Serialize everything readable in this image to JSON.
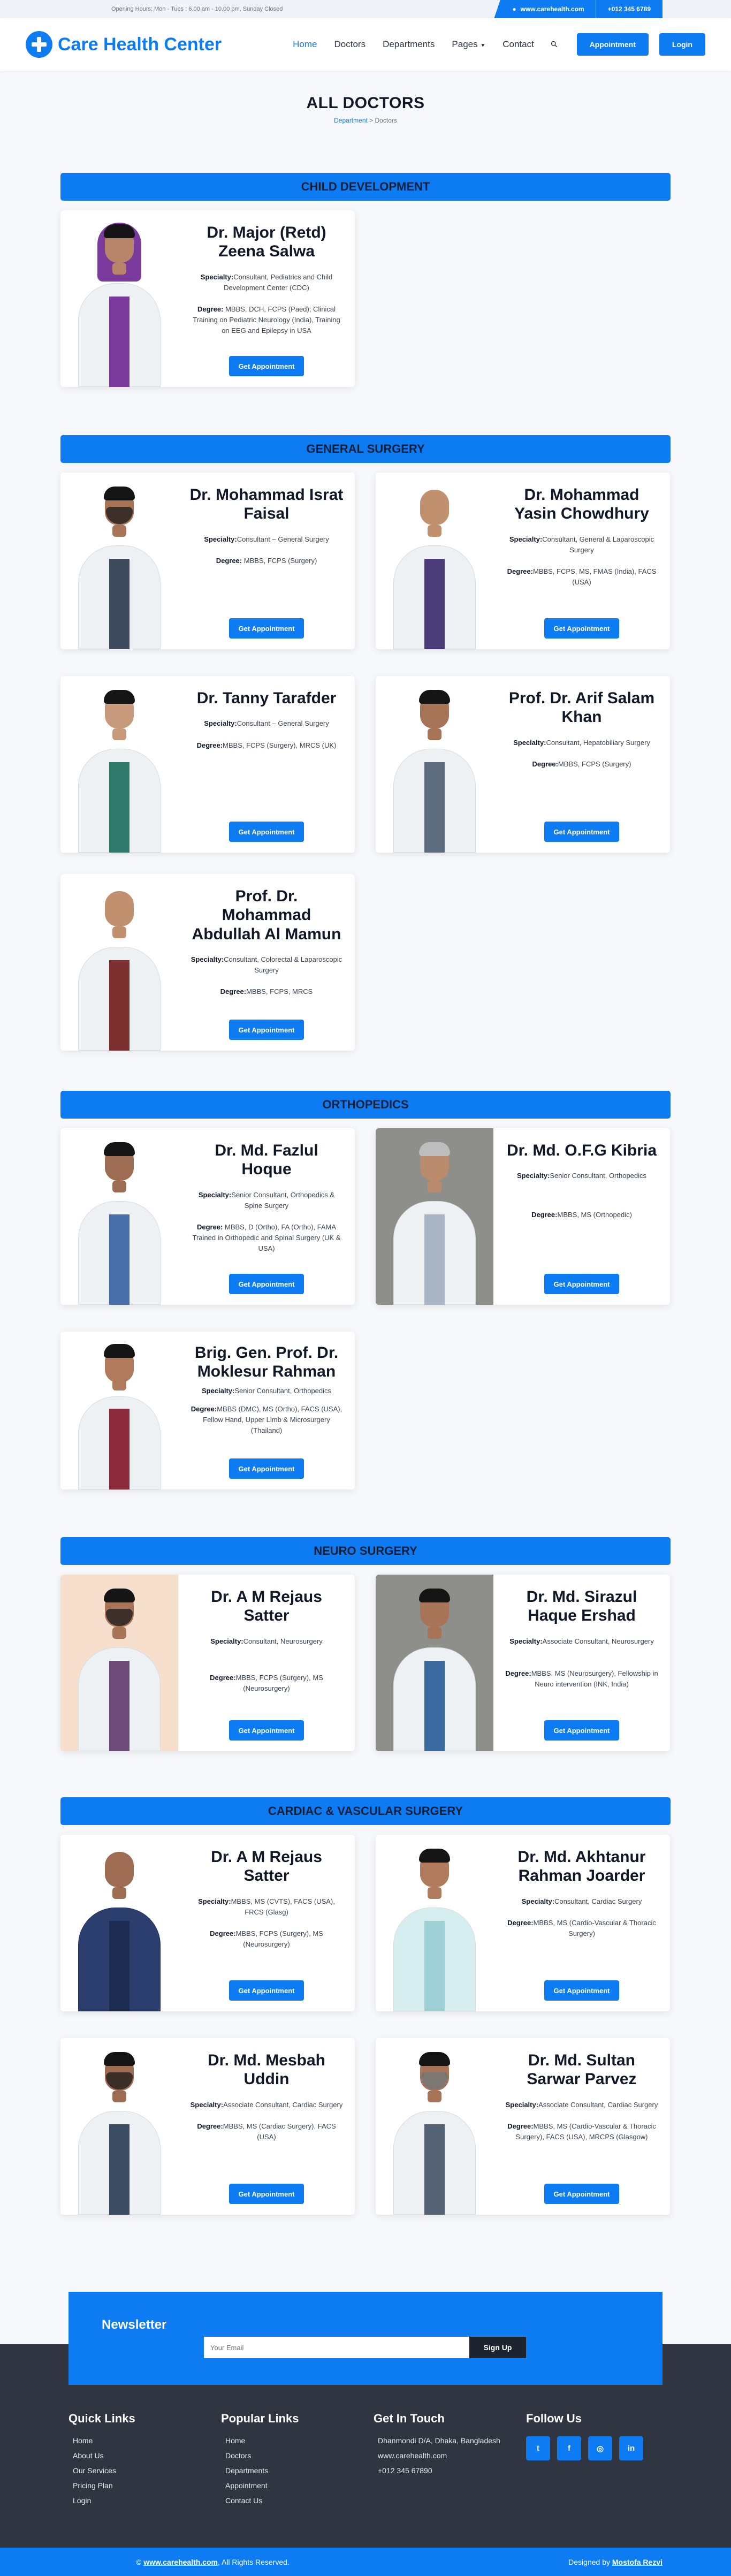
{
  "topbar": {
    "hours": "Opening Hours: Mon - Tues : 6.00 am - 10.00 pm, Sunday Closed",
    "website": "www.carehealth.com",
    "phone": "+012 345 6789"
  },
  "brand": {
    "name": "Care Health Center"
  },
  "nav": {
    "home": "Home",
    "doctors": "Doctors",
    "departments": "Departments",
    "pages": "Pages",
    "contact": "Contact",
    "appointment_btn": "Appointment",
    "login_btn": "Login"
  },
  "page": {
    "title": "ALL DOCTORS",
    "crumb_link": "Department",
    "crumb_sep": " > ",
    "crumb_current": "Doctors"
  },
  "cta_label": "Get Appointment",
  "labels": {
    "specialty": "Specialty:",
    "degree": "Degree:"
  },
  "departments": [
    {
      "name": "CHILD DEVELOPMENT",
      "doctors": [
        {
          "name": "Dr. Major (Retd) Zeena Salwa",
          "specialty": "Consultant, Pediatrics and Child Development Center (CDC)",
          "degree": "MBBS, DCH, FCPS (Paed); Clinical Training on Pediatric Neurology (India), Training on EEG and Epilepsy in USA"
        }
      ]
    },
    {
      "name": "GENERAL SURGERY",
      "doctors": [
        {
          "name": "Dr. Mohammad Israt Faisal",
          "specialty": "Consultant – General Surgery",
          "degree": "MBBS, FCPS (Surgery)"
        },
        {
          "name": "Dr. Mohammad Yasin Chowdhury",
          "specialty": "Consultant, General & Laparoscopic Surgery",
          "degree": "MBBS, FCPS, MS, FMAS (India), FACS (USA)"
        },
        {
          "name": "Dr. Tanny Tarafder",
          "specialty": "Consultant – General Surgery",
          "degree": "MBBS, FCPS (Surgery), MRCS (UK)"
        },
        {
          "name": "Prof. Dr. Arif Salam Khan",
          "specialty": "Consultant, Hepatobiliary Surgery",
          "degree": "MBBS, FCPS (Surgery)"
        },
        {
          "name": "Prof. Dr. Mohammad Abdullah Al Mamun",
          "specialty": "Consultant, Colorectal & Laparoscopic Surgery",
          "degree": "MBBS, FCPS, MRCS"
        }
      ]
    },
    {
      "name": "ORTHOPEDICS",
      "doctors": [
        {
          "name": "Dr. Md. Fazlul Hoque",
          "specialty": "Senior Consultant, Orthopedics & Spine Surgery",
          "degree": "MBBS, D (Ortho), FA (Ortho), FAMA Trained in Orthopedic and Spinal Surgery (UK & USA)"
        },
        {
          "name": "Dr. Md. O.F.G Kibria",
          "specialty": "Senior Consultant, Orthopedics",
          "degree": "MBBS, MS (Orthopedic)"
        },
        {
          "name": "Brig. Gen. Prof. Dr. Moklesur Rahman",
          "specialty": "Senior Consultant, Orthopedics",
          "degree": "MBBS (DMC), MS (Ortho), FACS (USA), Fellow Hand, Upper Limb & Microsurgery (Thailand)"
        }
      ]
    },
    {
      "name": "NEURO SURGERY",
      "doctors": [
        {
          "name": "Dr. A M Rejaus Satter",
          "specialty": "Consultant, Neurosurgery",
          "degree": "MBBS, FCPS (Surgery), MS (Neurosurgery)"
        },
        {
          "name": "Dr. Md. Sirazul Haque Ershad",
          "specialty": "Associate Consultant, Neurosurgery",
          "degree": "MBBS, MS (Neurosurgery), Fellowship in Neuro intervention (INK, India)"
        }
      ]
    },
    {
      "name": "CARDIAC & VASCULAR SURGERY",
      "doctors": [
        {
          "name": "Dr. A M Rejaus Satter",
          "specialty": "MBBS, MS (CVTS), FACS (USA), FRCS (Glasg)",
          "degree": "MBBS, FCPS (Surgery), MS (Neurosurgery)"
        },
        {
          "name": "Dr. Md. Akhtanur Rahman Joarder",
          "specialty": "Consultant, Cardiac Surgery",
          "degree": "MBBS, MS (Cardio-Vascular & Thoracic Surgery)"
        },
        {
          "name": "Dr. Md. Mesbah Uddin",
          "specialty": "Associate Consultant, Cardiac Surgery",
          "degree": "MBBS, MS (Cardiac Surgery), FACS (USA)"
        },
        {
          "name": "Dr. Md. Sultan Sarwar Parvez",
          "specialty": "Associate Consultant, Cardiac Surgery",
          "degree": "MBBS, MS (Cardio-Vascular & Thoracic Surgery), FACS (USA), MRCPS (Glasgow)"
        }
      ]
    }
  ],
  "newsletter": {
    "title": "Newsletter",
    "placeholder": "Your Email",
    "button": "Sign Up"
  },
  "footer": {
    "quick_title": "Quick Links",
    "quick": [
      "Home",
      "About Us",
      "Our Services",
      "Pricing Plan",
      "Login"
    ],
    "popular_title": "Popular Links",
    "popular": [
      "Home",
      "Doctors",
      "Departments",
      "Appointment",
      "Contact Us"
    ],
    "touch_title": "Get In Touch",
    "touch": [
      "Dhanmondi D/A, Dhaka, Bangladesh",
      "www.carehealth.com",
      "+012 345 67890"
    ],
    "follow_title": "Follow Us",
    "socials": [
      "twitter-icon",
      "facebook-icon",
      "instagram-icon",
      "linkedin-icon"
    ]
  },
  "copyright": {
    "prefix": "© ",
    "site": "www.carehealth.com",
    "suffix": ", All Rights Reserved.",
    "designed_prefix": "Designed by ",
    "designer": "Mostofa Rezvi"
  },
  "colors": {
    "primary": "#0d7bf2",
    "footer": "#303641",
    "dark": "#1d2430"
  }
}
